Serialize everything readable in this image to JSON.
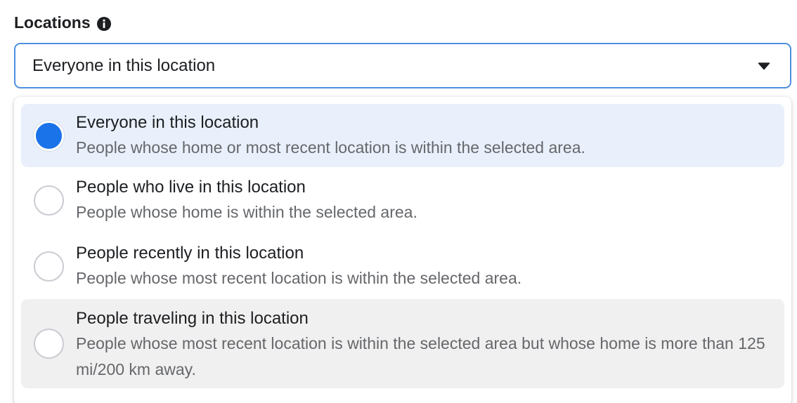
{
  "section": {
    "title": "Locations"
  },
  "select": {
    "value": "Everyone in this location"
  },
  "options": [
    {
      "title": "Everyone in this location",
      "description": "People whose home or most recent location is within the selected area.",
      "selected": true
    },
    {
      "title": "People who live in this location",
      "description": "People whose home is within the selected area.",
      "selected": false
    },
    {
      "title": "People recently in this location",
      "description": "People whose most recent location is within the selected area.",
      "selected": false
    },
    {
      "title": "People traveling in this location",
      "description": "People whose most recent location is within the selected area but whose home is more than 125 mi/200 km away.",
      "selected": false
    }
  ],
  "icons": {
    "info": "info-icon",
    "caret": "caret-down-icon"
  },
  "colors": {
    "accent": "#1a73e8",
    "selected_bg": "#e9f0fb",
    "hover_bg": "#f0f0f0",
    "select_border": "#4d8fe0"
  }
}
